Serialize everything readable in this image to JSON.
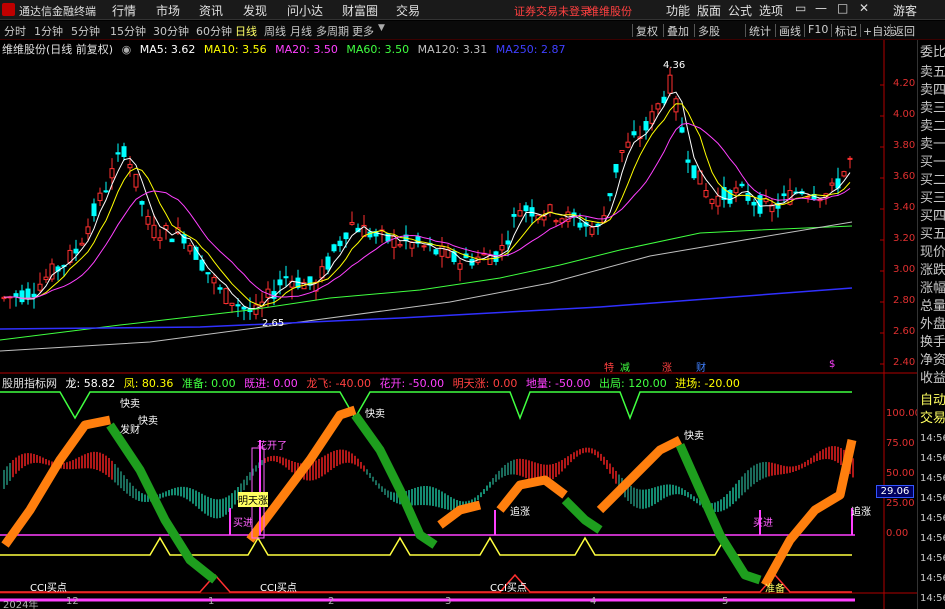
{
  "app": {
    "title": "通达信金融终端",
    "menus": [
      "行情",
      "市场",
      "资讯",
      "发现",
      "问小达",
      "财富圈",
      "交易"
    ],
    "notice": "证券交易未登录",
    "stock_name_top": "维维股份",
    "right_menus": [
      "功能",
      "版面",
      "公式",
      "选项"
    ],
    "guest": "游客"
  },
  "toolbar": {
    "periods": [
      "分时",
      "1分钟",
      "5分钟",
      "15分钟",
      "30分钟",
      "60分钟",
      "日线",
      "周线",
      "月线",
      "多周期",
      "更多"
    ],
    "active_period": "日线",
    "buttons": [
      "复权",
      "叠加",
      "多股",
      "统计",
      "画线",
      "F10",
      "标记",
      "+自选",
      "返回"
    ]
  },
  "main_legend": {
    "stock": "维维股份(日线 前复权)",
    "mas": [
      {
        "label": "MA5: 3.62",
        "color": "#ffffff"
      },
      {
        "label": "MA10: 3.56",
        "color": "#ffff00"
      },
      {
        "label": "MA20: 3.50",
        "color": "#ff40ff"
      },
      {
        "label": "MA60: 3.50",
        "color": "#40ff40"
      },
      {
        "label": "MA120: 3.31",
        "color": "#c0c0c0"
      },
      {
        "label": "MA250: 2.87",
        "color": "#4040ff"
      }
    ]
  },
  "price_axis": [
    "4.20",
    "4.00",
    "3.80",
    "3.60",
    "3.40",
    "3.20",
    "3.00",
    "2.80",
    "2.60",
    "2.40"
  ],
  "price_marks": {
    "high": "4.36",
    "low": "2.65"
  },
  "event_markers": [
    {
      "text": "特",
      "color": "#ff4040"
    },
    {
      "text": "减",
      "color": "#40ff40"
    },
    {
      "text": "涨",
      "color": "#ff4040"
    },
    {
      "text": "财",
      "color": "#4080ff"
    },
    {
      "text": "$",
      "color": "#ff40ff"
    }
  ],
  "indicator_legend": {
    "name": "股朋指标网",
    "items": [
      {
        "label": "龙: 58.82",
        "color": "#ffffff"
      },
      {
        "label": "凤: 80.36",
        "color": "#ffff00"
      },
      {
        "label": "准备: 0.00",
        "color": "#40ff40"
      },
      {
        "label": "既进: 0.00",
        "color": "#ff40ff"
      },
      {
        "label": "龙飞: -40.00",
        "color": "#ff4040"
      },
      {
        "label": "花开: -50.00",
        "color": "#ff40ff"
      },
      {
        "label": "明天涨: 0.00",
        "color": "#ff4040"
      },
      {
        "label": "地量: -50.00",
        "color": "#ff40ff"
      },
      {
        "label": "出局: 120.00",
        "color": "#40ff40"
      },
      {
        "label": "进场: -20.00",
        "color": "#ffff00"
      }
    ]
  },
  "indicator_axis": [
    "100.00",
    "75.00",
    "50.00",
    "25.00",
    "0.00"
  ],
  "indicator_current": "29.06",
  "signals": {
    "sell_fast": "快卖",
    "fa_chai": "发财",
    "hua_kai": "花开了",
    "ming_tian_zhang": "明天涨",
    "buy_in": "买进",
    "zhui_zhang": "追涨",
    "long": "龙",
    "cci_buy": "CCI买点",
    "zhun_bei": "准备"
  },
  "x_axis": [
    "2024年",
    "12",
    "1",
    "2",
    "3",
    "4",
    "5"
  ],
  "right_panel": [
    "委比",
    "卖五",
    "卖四",
    "卖三",
    "卖二",
    "卖一",
    "买一",
    "买二",
    "买三",
    "买四",
    "买五",
    "现价",
    "涨跌",
    "涨幅",
    "总量",
    "外盘",
    "换手",
    "净资",
    "收益",
    "自动",
    "交易"
  ],
  "time_labels": [
    "14:56",
    "14:56",
    "14:56",
    "14:56",
    "14:56",
    "14:56",
    "14:56",
    "14:56",
    "14:56"
  ],
  "colors": {
    "up": "#ff3030",
    "down": "#00ffff",
    "orange": "#ff7f0e",
    "green": "#1e9e1e",
    "magenta": "#ff40ff"
  }
}
